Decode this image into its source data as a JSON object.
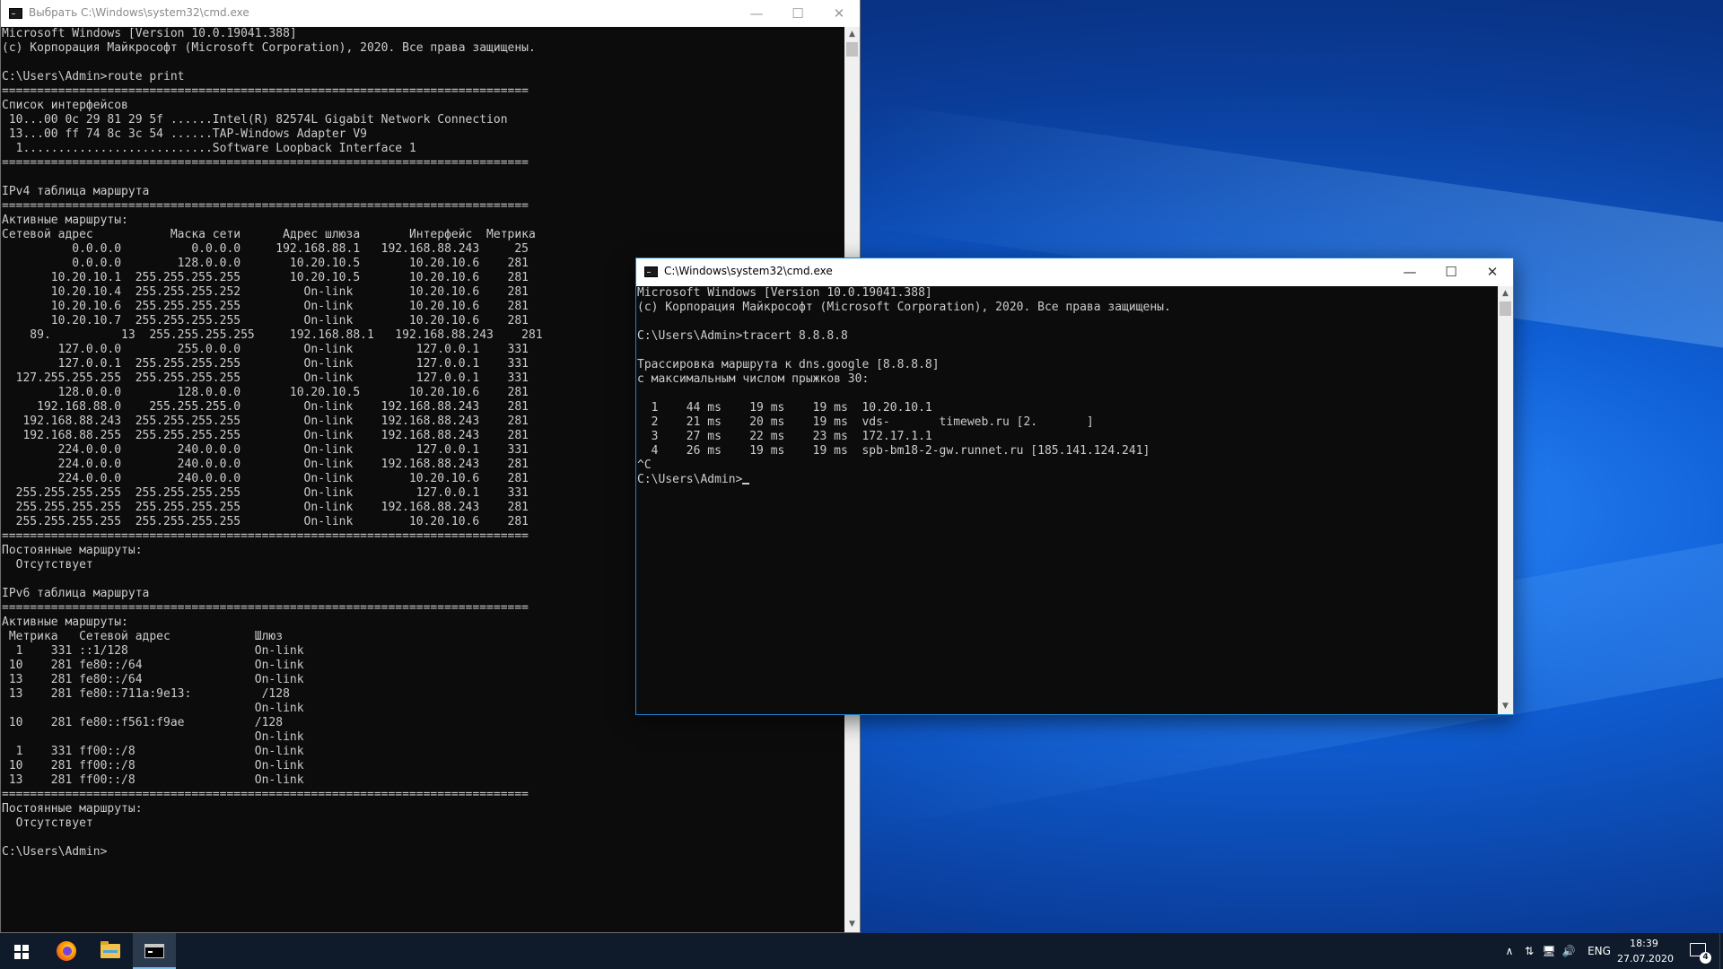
{
  "window1": {
    "title": "Выбрать C:\\Windows\\system32\\cmd.exe",
    "lines": [
      "Microsoft Windows [Version 10.0.19041.388]",
      "(c) Корпорация Майкрософт (Microsoft Corporation), 2020. Все права защищены.",
      "",
      "C:\\Users\\Admin>route print",
      "===========================================================================",
      "Список интерфейсов",
      " 10...00 0c 29 81 29 5f ......Intel(R) 82574L Gigabit Network Connection",
      " 13...00 ff 74 8c 3c 54 ......TAP-Windows Adapter V9",
      "  1...........................Software Loopback Interface 1",
      "===========================================================================",
      "",
      "IPv4 таблица маршрута",
      "===========================================================================",
      "Активные маршруты:",
      "Сетевой адрес           Маска сети      Адрес шлюза       Интерфейс  Метрика",
      "          0.0.0.0          0.0.0.0     192.168.88.1   192.168.88.243     25",
      "          0.0.0.0        128.0.0.0       10.20.10.5       10.20.10.6    281",
      "       10.20.10.1  255.255.255.255       10.20.10.5       10.20.10.6    281",
      "       10.20.10.4  255.255.255.252         On-link        10.20.10.6    281",
      "       10.20.10.6  255.255.255.255         On-link        10.20.10.6    281",
      "       10.20.10.7  255.255.255.255         On-link        10.20.10.6    281",
      "    89.          13  255.255.255.255     192.168.88.1   192.168.88.243    281",
      "        127.0.0.0        255.0.0.0         On-link         127.0.0.1    331",
      "        127.0.0.1  255.255.255.255         On-link         127.0.0.1    331",
      "  127.255.255.255  255.255.255.255         On-link         127.0.0.1    331",
      "        128.0.0.0        128.0.0.0       10.20.10.5       10.20.10.6    281",
      "     192.168.88.0    255.255.255.0         On-link    192.168.88.243    281",
      "   192.168.88.243  255.255.255.255         On-link    192.168.88.243    281",
      "   192.168.88.255  255.255.255.255         On-link    192.168.88.243    281",
      "        224.0.0.0        240.0.0.0         On-link         127.0.0.1    331",
      "        224.0.0.0        240.0.0.0         On-link    192.168.88.243    281",
      "        224.0.0.0        240.0.0.0         On-link        10.20.10.6    281",
      "  255.255.255.255  255.255.255.255         On-link         127.0.0.1    331",
      "  255.255.255.255  255.255.255.255         On-link    192.168.88.243    281",
      "  255.255.255.255  255.255.255.255         On-link        10.20.10.6    281",
      "===========================================================================",
      "Постоянные маршруты:",
      "  Отсутствует",
      "",
      "IPv6 таблица маршрута",
      "===========================================================================",
      "Активные маршруты:",
      " Метрика   Сетевой адрес            Шлюз",
      "  1    331 ::1/128                  On-link",
      " 10    281 fe80::/64                On-link",
      " 13    281 fe80::/64                On-link",
      " 13    281 fe80::711a:9e13:          /128",
      "                                    On-link",
      " 10    281 fe80::f561:f9ae          /128",
      "                                    On-link",
      "  1    331 ff00::/8                 On-link",
      " 10    281 ff00::/8                 On-link",
      " 13    281 ff00::/8                 On-link",
      "===========================================================================",
      "Постоянные маршруты:",
      "  Отсутствует",
      "",
      "C:\\Users\\Admin>"
    ]
  },
  "window2": {
    "title": "C:\\Windows\\system32\\cmd.exe",
    "lines": [
      "Microsoft Windows [Version 10.0.19041.388]",
      "(c) Корпорация Майкрософт (Microsoft Corporation), 2020. Все права защищены.",
      "",
      "C:\\Users\\Admin>tracert 8.8.8.8",
      "",
      "Трассировка маршрута к dns.google [8.8.8.8]",
      "с максимальным числом прыжков 30:",
      "",
      "  1    44 ms    19 ms    19 ms  10.20.10.1",
      "  2    21 ms    20 ms    19 ms  vds-       timeweb.ru [2.       ]",
      "  3    27 ms    22 ms    23 ms  172.17.1.1",
      "  4    26 ms    19 ms    19 ms  spb-bm18-2-gw.runnet.ru [185.141.124.241]",
      "^C"
    ],
    "prompt": "C:\\Users\\Admin>"
  },
  "controls": {
    "minimize": "—",
    "maximize": "☐",
    "close": "✕",
    "scroll_up": "▲",
    "scroll_down": "▼"
  },
  "taskbar": {
    "apps": [
      {
        "name": "firefox-icon"
      },
      {
        "name": "file-explorer-icon"
      },
      {
        "name": "cmd-icon"
      }
    ],
    "tray": {
      "chevron": "∧",
      "network1": "⇅",
      "network2": "🖥",
      "volume": "🔊",
      "language": "ENG"
    },
    "time": "18:39",
    "date": "27.07.2020",
    "notification_count": "4"
  },
  "colors": {
    "console_bg": "#0c0c0c",
    "console_fg": "#cccccc",
    "accent": "#1883d7",
    "taskbar": "#0f1b2b"
  }
}
